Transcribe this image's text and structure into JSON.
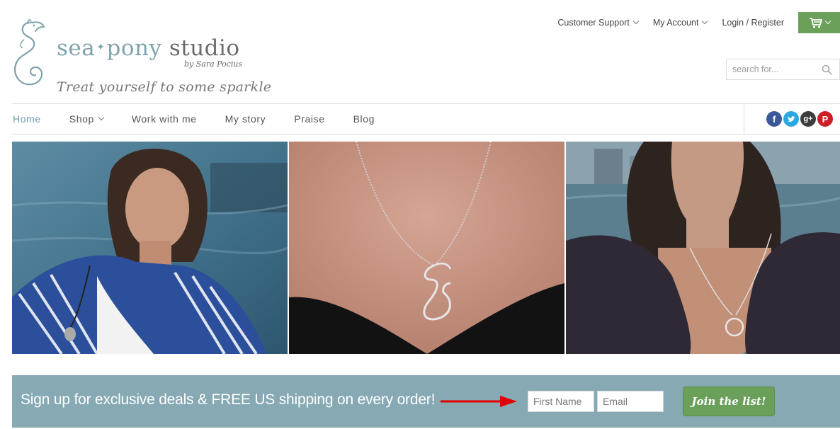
{
  "brand": {
    "name_part1": "sea",
    "name_part2": "pony",
    "name_part3": "studio",
    "byline": "by Sara Pocius",
    "tagline": "Treat yourself to some sparkle"
  },
  "topnav": {
    "items": [
      {
        "label": "Customer Support",
        "has_dropdown": true
      },
      {
        "label": "My Account",
        "has_dropdown": true
      },
      {
        "label": "Login / Register",
        "has_dropdown": false
      }
    ],
    "cart_icon": "shopping-cart-icon"
  },
  "search": {
    "placeholder": "search for...",
    "icon": "search-icon"
  },
  "mainnav": {
    "items": [
      {
        "label": "Home",
        "active": true
      },
      {
        "label": "Shop",
        "has_dropdown": true
      },
      {
        "label": "Work with me"
      },
      {
        "label": "My story"
      },
      {
        "label": "Praise"
      },
      {
        "label": "Blog"
      }
    ]
  },
  "social": [
    {
      "name": "facebook-icon",
      "glyph": "f",
      "color": "#3b5998"
    },
    {
      "name": "twitter-icon",
      "glyph": "t",
      "color": "#2aa9e0"
    },
    {
      "name": "googleplus-icon",
      "glyph": "g+",
      "color": "#3c3c3c"
    },
    {
      "name": "pinterest-icon",
      "glyph": "P",
      "color": "#cb2027"
    }
  ],
  "photos": [
    {
      "name": "woman-owl-necklace-photo"
    },
    {
      "name": "cat-pendant-closeup-photo"
    },
    {
      "name": "woman-cat-pendant-photo"
    }
  ],
  "signup": {
    "message": "Sign up for exclusive deals & FREE US shipping on every order!",
    "first_name_placeholder": "First Name",
    "email_placeholder": "Email",
    "button_label": "Join the list!"
  },
  "colors": {
    "accent_green": "#6aa05a",
    "signup_bg": "#86a9b4",
    "brand_teal": "#7fa3ac",
    "arrow_red": "#e00000"
  }
}
